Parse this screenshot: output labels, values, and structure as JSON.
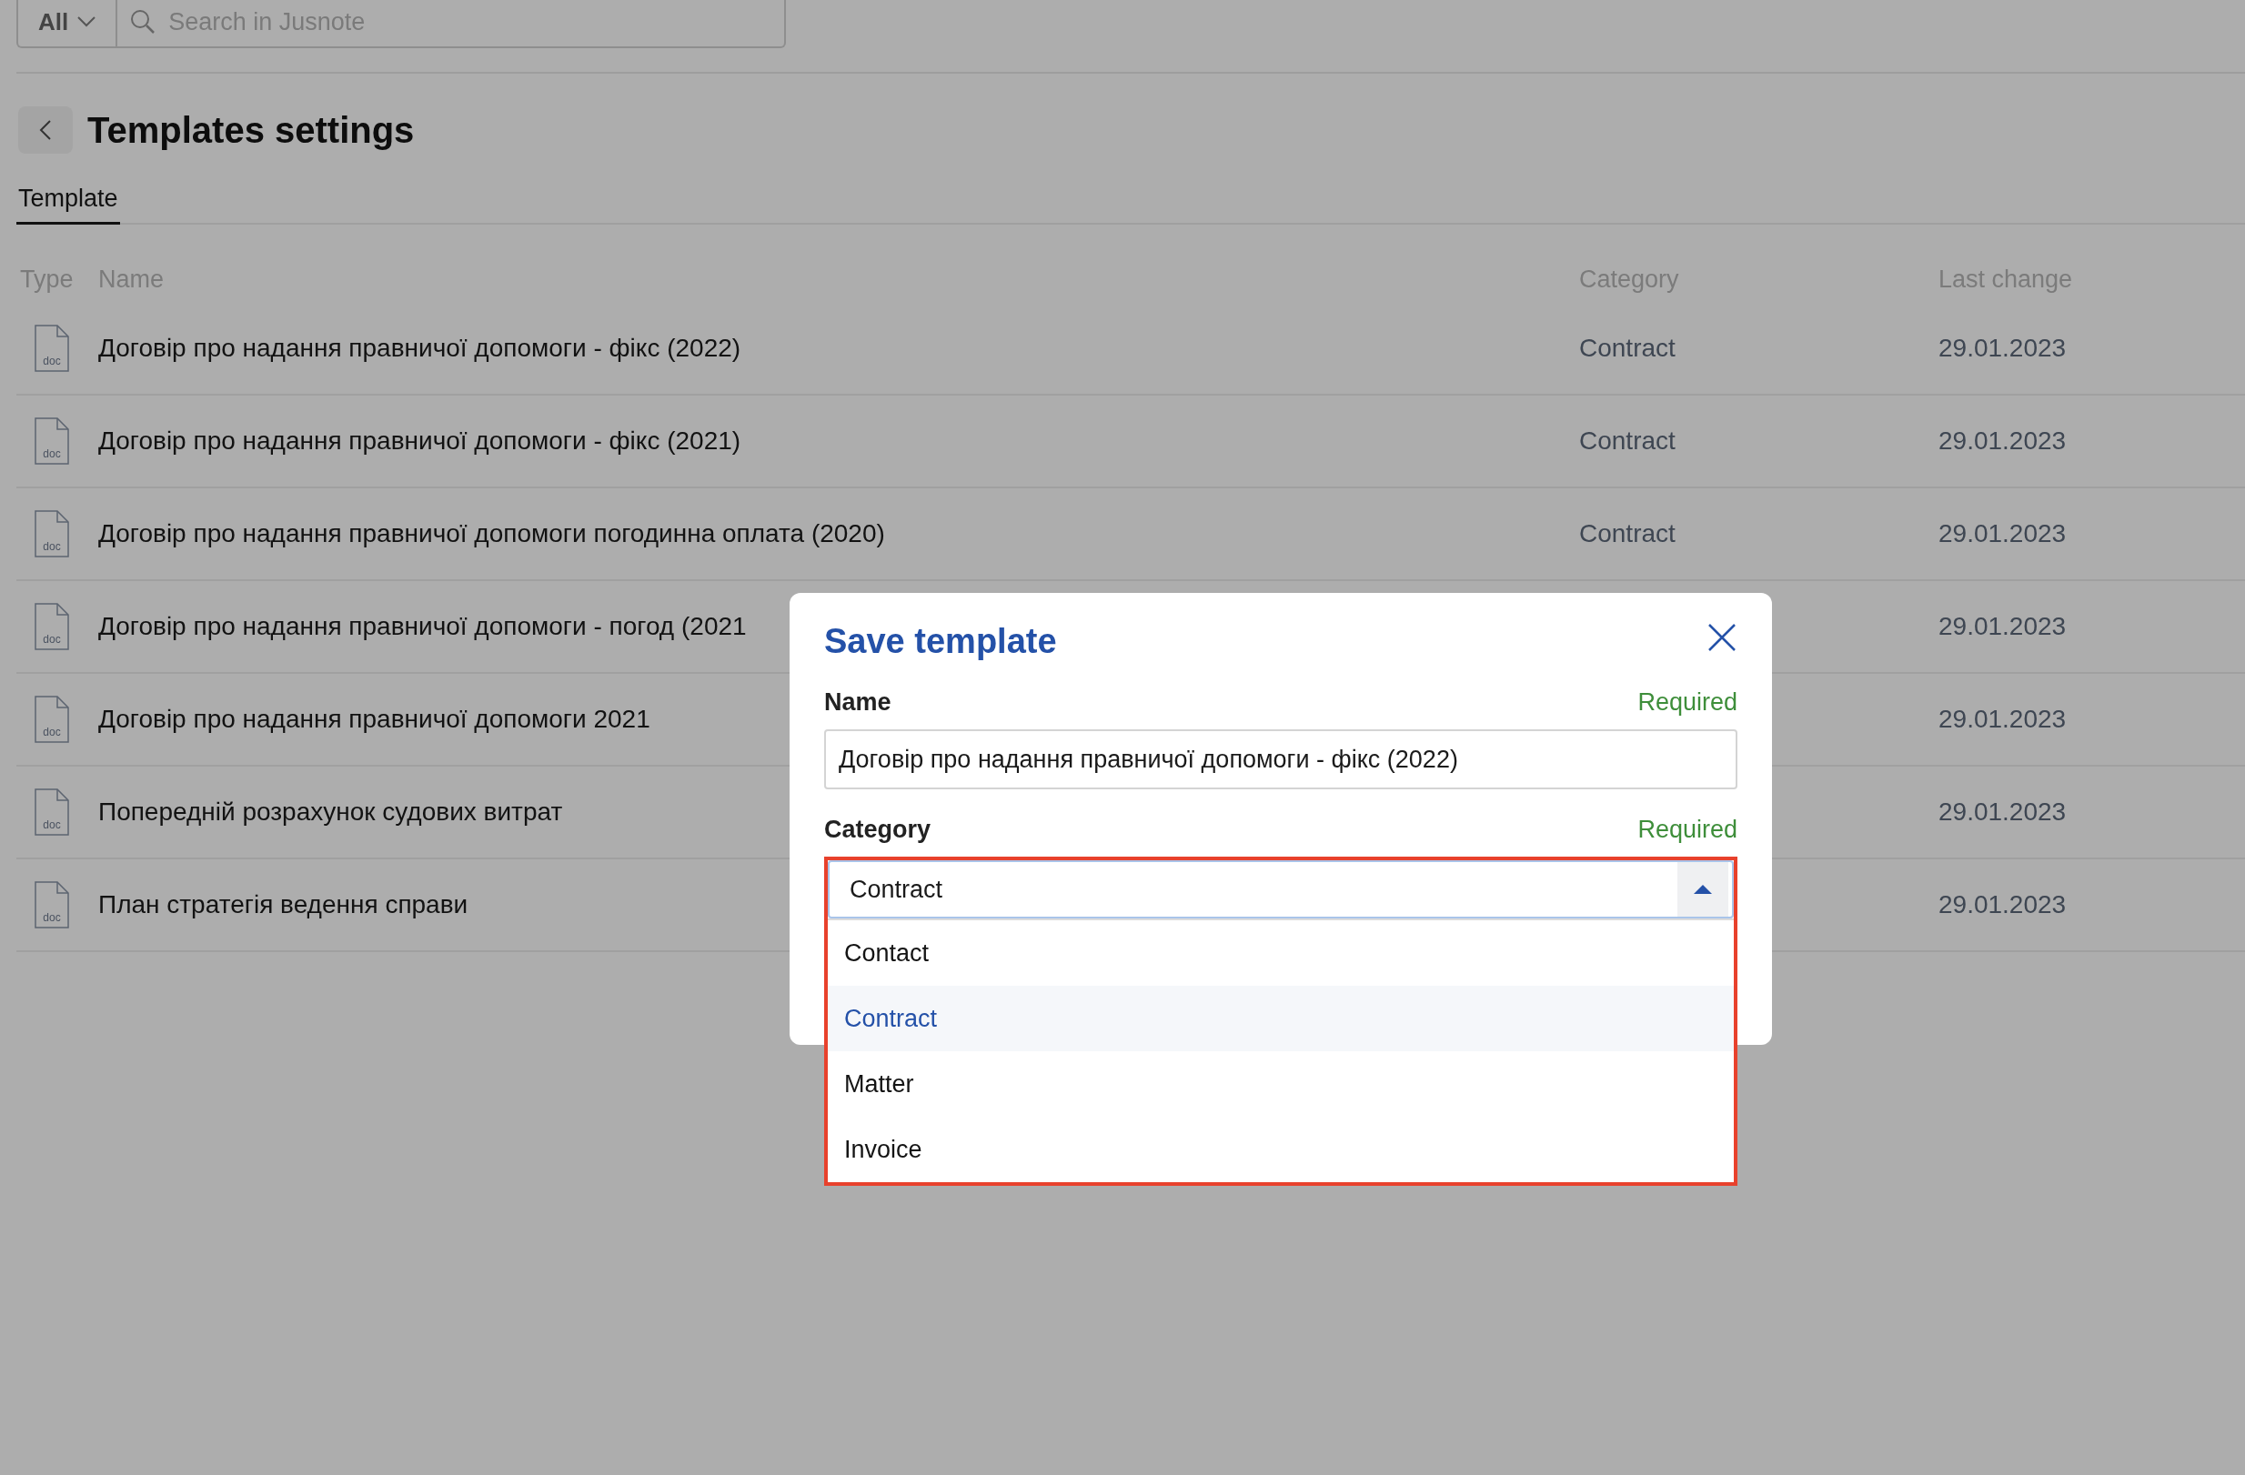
{
  "search": {
    "scope": "All",
    "placeholder": "Search in Jusnote"
  },
  "page": {
    "title": "Templates settings"
  },
  "tabs": [
    {
      "label": "Template",
      "selected": true
    }
  ],
  "table": {
    "columns": [
      "Type",
      "Name",
      "Category",
      "Last change"
    ],
    "rows": [
      {
        "type": "doc",
        "name": "Договір про надання правничої допомоги - фікс (2022)",
        "category": "Contract",
        "last_change": "29.01.2023"
      },
      {
        "type": "doc",
        "name": "Договір про надання правничої допомоги - фікс (2021)",
        "category": "Contract",
        "last_change": "29.01.2023"
      },
      {
        "type": "doc",
        "name": "Договір про надання правничої допомоги погодинна оплата (2020)",
        "category": "Contract",
        "last_change": "29.01.2023"
      },
      {
        "type": "doc",
        "name": "Договір про надання правничої допомоги - погод (2021",
        "last_change": "29.01.2023"
      },
      {
        "type": "doc",
        "name": "Договір про надання правничої допомоги 2021",
        "last_change": "29.01.2023"
      },
      {
        "type": "doc",
        "name": "Попередній розрахунок судових витрат",
        "last_change": "29.01.2023"
      },
      {
        "type": "doc",
        "name": "План стратегія ведення справи",
        "last_change": "29.01.2023"
      }
    ]
  },
  "dialog": {
    "title": "Save template",
    "fields": [
      {
        "kind": "text",
        "label": "Name",
        "hint": "Required",
        "value": "Договір про надання правничої допомоги - фікс (2022)"
      },
      {
        "kind": "select",
        "label": "Category",
        "hint": "Required",
        "value": "Contract",
        "expanded": true,
        "options": [
          {
            "label": "Contact",
            "selected": false
          },
          {
            "label": "Contract",
            "selected": true
          },
          {
            "label": "Matter",
            "selected": false
          },
          {
            "label": "Invoice",
            "selected": false
          }
        ]
      }
    ]
  }
}
